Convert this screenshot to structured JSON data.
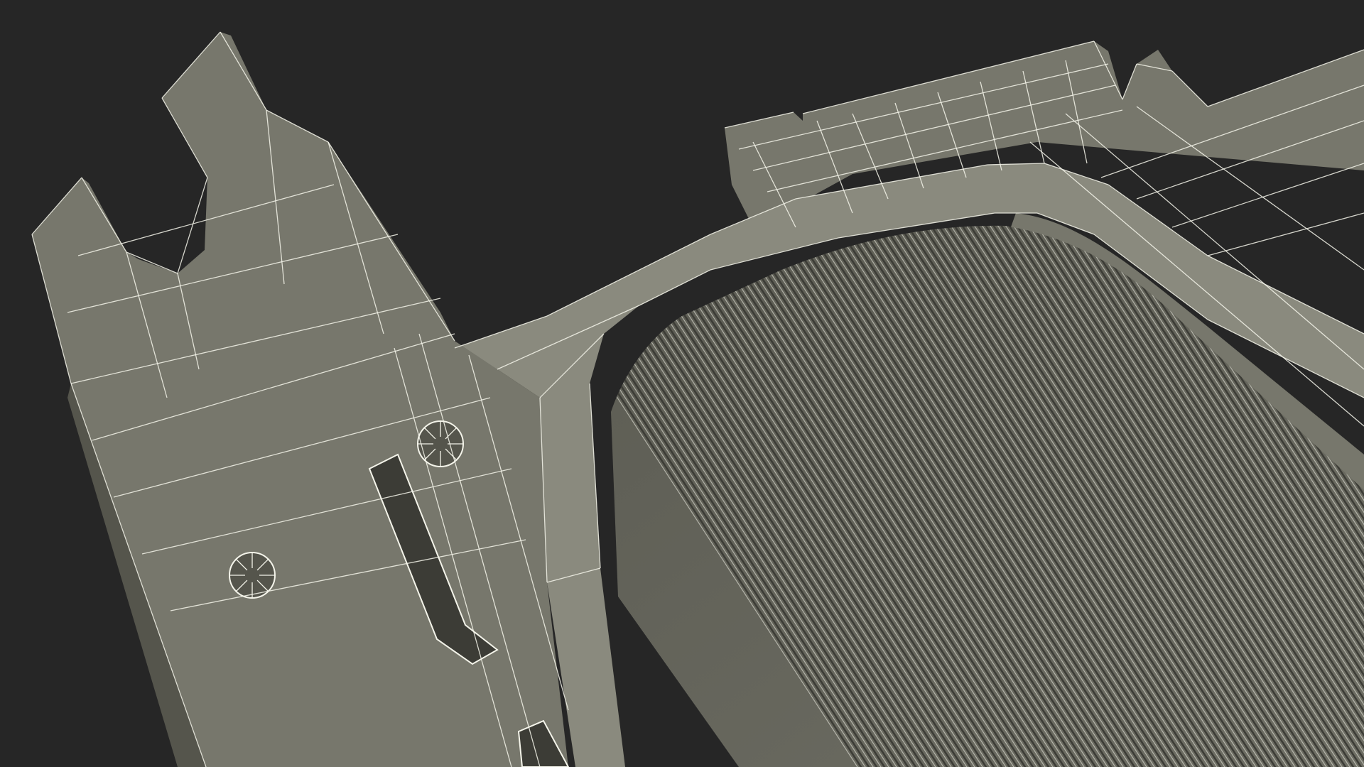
{
  "viewport": {
    "background_color": "#262626"
  },
  "model": {
    "surface_color": "#77776c",
    "surface_light_color": "#8a8a7e",
    "surface_dark_color": "#55554c",
    "shadow_color": "#3c3c36",
    "wire_color": "#f4f4ea",
    "wire_opacity": 0.85,
    "fin_count": 118,
    "parts": [
      {
        "name": "bracket"
      },
      {
        "name": "top-flange"
      },
      {
        "name": "rim-frame"
      },
      {
        "name": "fin-block"
      },
      {
        "name": "slot-vent"
      },
      {
        "name": "screw-boss"
      }
    ]
  }
}
